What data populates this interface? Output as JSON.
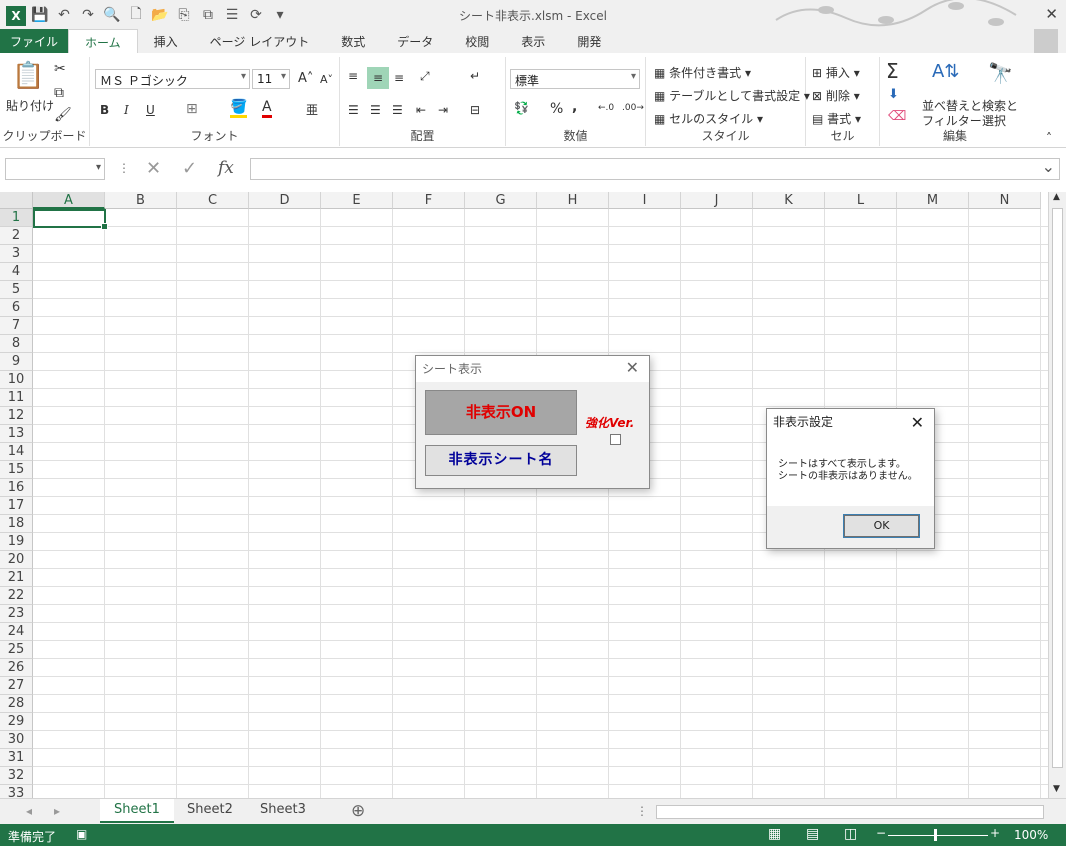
{
  "window": {
    "title": "シート非表示.xlsm - Excel",
    "excel_logo": "X"
  },
  "ribbon_tabs": [
    "ファイル",
    "ホーム",
    "挿入",
    "ページ レイアウト",
    "数式",
    "データ",
    "校閲",
    "表示",
    "開発"
  ],
  "ribbon": {
    "clipboard": {
      "paste": "貼り付け",
      "label": "クリップボード"
    },
    "font": {
      "name": "ＭＳ Ｐゴシック",
      "size": "11",
      "bold": "B",
      "italic": "I",
      "underline": "U",
      "label": "フォント"
    },
    "alignment": {
      "label": "配置"
    },
    "number": {
      "format": "標準",
      "percent": "%",
      "comma": ",",
      "label": "数値"
    },
    "styles": {
      "cond": "条件付き書式",
      "table": "テーブルとして書式設定",
      "cell": "セルのスタイル",
      "label": "スタイル"
    },
    "cells": {
      "insert": "挿入",
      "delete": "削除",
      "format": "書式",
      "label": "セル"
    },
    "editing": {
      "sort": "並べ替えと",
      "sort2": "フィルター",
      "find": "検索と",
      "find2": "選択",
      "label": "編集"
    }
  },
  "formula_bar": {
    "fx": "fx",
    "value": ""
  },
  "columns": [
    "A",
    "B",
    "C",
    "D",
    "E",
    "F",
    "G",
    "H",
    "I",
    "J",
    "K",
    "L",
    "M",
    "N"
  ],
  "rows": [
    "1",
    "2",
    "3",
    "4",
    "5",
    "6",
    "7",
    "8",
    "9",
    "10",
    "11",
    "12",
    "13",
    "14",
    "15",
    "16",
    "17",
    "18",
    "19",
    "20",
    "21",
    "22",
    "23",
    "24",
    "25",
    "26",
    "27",
    "28",
    "29",
    "30",
    "31",
    "32",
    "33"
  ],
  "sheets": [
    "Sheet1",
    "Sheet2",
    "Sheet3"
  ],
  "status": {
    "ready": "準備完了",
    "zoom": "100%"
  },
  "dialog_sheet": {
    "title": "シート表示",
    "btn_hide_on": "非表示ON",
    "btn_hidden_names": "非表示シート名",
    "enhanced_label": "強化Ver."
  },
  "dialog_msg": {
    "title": "非表示設定",
    "line1": "シートはすべて表示します。",
    "line2": "シートの非表示はありません。",
    "ok": "OK"
  },
  "colors": {
    "excel_green": "#217346",
    "red_text": "#e00000",
    "blue_text": "#000099"
  }
}
